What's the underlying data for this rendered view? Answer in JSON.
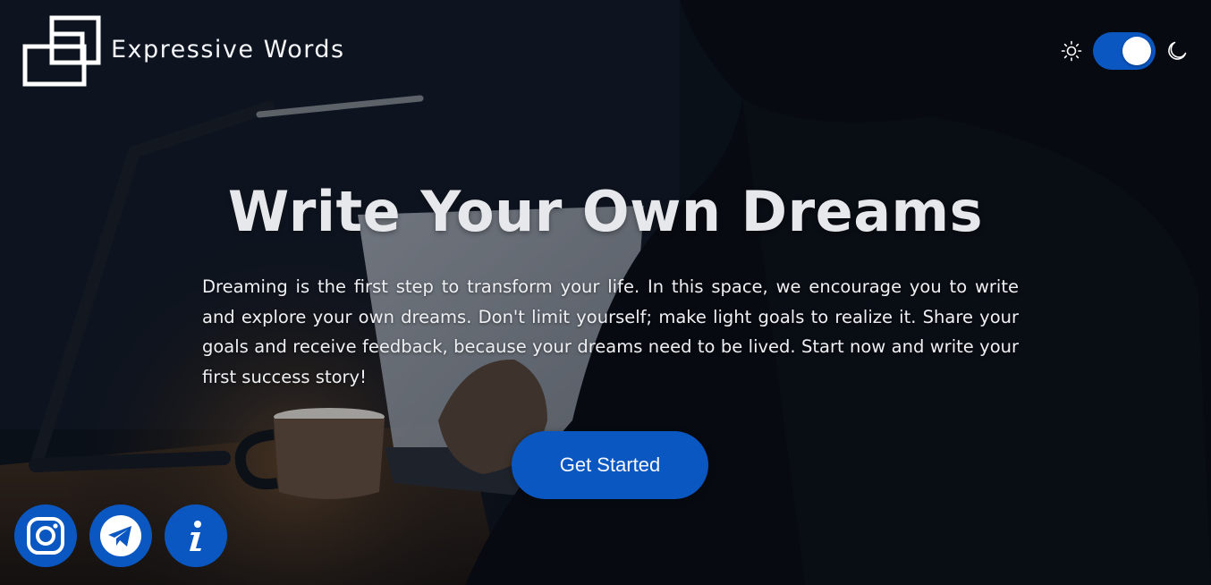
{
  "header": {
    "brand": "Expressive Words"
  },
  "theme_toggle": {
    "state": "dark",
    "light_icon": "sun-icon",
    "dark_icon": "moon-icon"
  },
  "hero": {
    "title": "Write Your Own Dreams",
    "description": "Dreaming is the first step to transform your life. In this space, we encourage you to write and explore your own dreams. Don't limit yourself; make light goals to realize it. Share your goals and receive feedback, because your dreams need to be lived. Start now and write your first success story!",
    "cta_label": "Get Started"
  },
  "social": [
    {
      "name": "instagram",
      "icon": "instagram-icon"
    },
    {
      "name": "telegram",
      "icon": "telegram-icon"
    },
    {
      "name": "info",
      "icon": "info-icon"
    }
  ],
  "colors": {
    "accent": "#0A57C2",
    "text": "#EEF0F3",
    "background": "#0B0F16"
  }
}
